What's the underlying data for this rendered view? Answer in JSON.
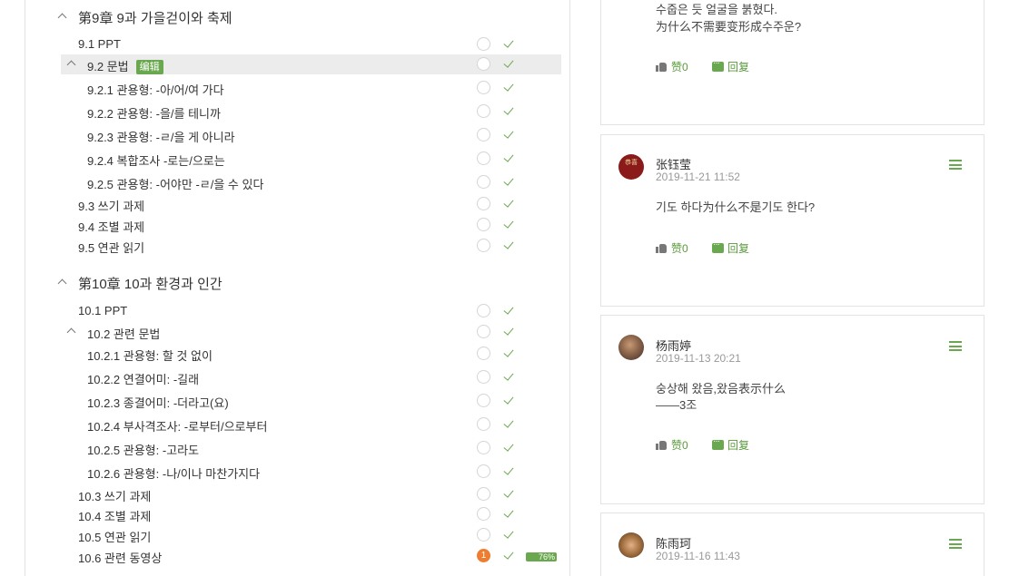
{
  "tree": {
    "ch9": {
      "title": "第9章 9과 가을걷이와 축제"
    },
    "r91": "9.1  PPT",
    "r92": "9.2  문법",
    "r92_badge": "编辑",
    "r921": "9.2.1 관용형: -아/어/여 가다",
    "r922": "9.2.2 관용형: -을/를 테니까",
    "r923": "9.2.3 관용형: -ㄹ/을 게 아니라",
    "r924": "9.2.4 복합조사 -로는/으로는",
    "r925": "9.2.5 관용형: -어야만 -ㄹ/을 수 있다",
    "r93": "9.3  쓰기 과제",
    "r94": "9.4  조별 과제",
    "r95": "9.5  연관 읽기",
    "ch10": {
      "title": "第10章 10과 환경과 인간"
    },
    "r101": "10.1  PPT",
    "r102": "10.2  관련 문법",
    "r1021": "10.2.1 관용형: 할 것 없이",
    "r1022": "10.2.2 연결어미: -길래",
    "r1023": "10.2.3 종결어미: -더라고(요)",
    "r1024": "10.2.4 부사격조사: -로부터/으로부터",
    "r1025": "10.2.5 관용형: -고라도",
    "r1026": "10.2.6 관용형: -나/이나 마찬가지다",
    "r103": "10.3  쓰기 과제",
    "r104": "10.4  조별 과제",
    "r105": "10.5  연관 읽기",
    "r106": "10.6  관련 동영상",
    "r106_count": "1",
    "r106_progress": "76%",
    "r106_progress_value": 0.76
  },
  "comments": {
    "c0": {
      "text_line1": "수줍은 듯 얼굴을 붉혔다.",
      "text_line2": "为什么不需要变形成수주운?",
      "like": "赞0",
      "reply": "回复"
    },
    "c1": {
      "name": "张钰莹",
      "time": "2019-11-21 11:52",
      "text_line1": "기도 하다为什么不是기도 한다?",
      "avatar_text": "恭喜",
      "like": "赞0",
      "reply": "回复"
    },
    "c2": {
      "name": "杨雨婷",
      "time": "2019-11-13 20:21",
      "text_line1": "숭상해 왔음,왔음表示什么",
      "text_line2": "——3조",
      "like": "赞0",
      "reply": "回复"
    },
    "c3": {
      "name": "陈雨珂",
      "time": "2019-11-16 11:43"
    }
  },
  "colors": {
    "accent": "#6aa84f",
    "badge_orange": "#ef7d2f",
    "active_row": "#ececec"
  }
}
